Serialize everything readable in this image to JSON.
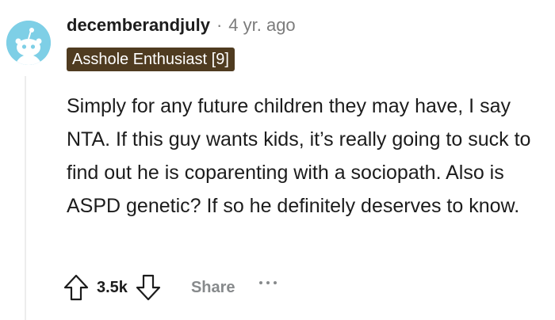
{
  "comment": {
    "author": "decemberandjuly",
    "separator": "·",
    "timestamp": "4 yr. ago",
    "flair": "Asshole Enthusiast [9]",
    "body": "Simply for any future children they may have, I say NTA. If this guy wants kids, it’s really going to suck to find out he is coparenting with a sociopath. Also is ASPD genetic? If so he definitely deserves to know.",
    "score": "3.5k",
    "share_label": "Share"
  },
  "icons": {
    "avatar": "snoo-avatar-icon",
    "upvote": "upvote-arrow-icon",
    "downvote": "downvote-arrow-icon",
    "more": "more-options-icon"
  },
  "colors": {
    "avatar_bg": "#7ecfe6",
    "flair_bg": "#4f3b20",
    "muted": "#878a8c"
  }
}
